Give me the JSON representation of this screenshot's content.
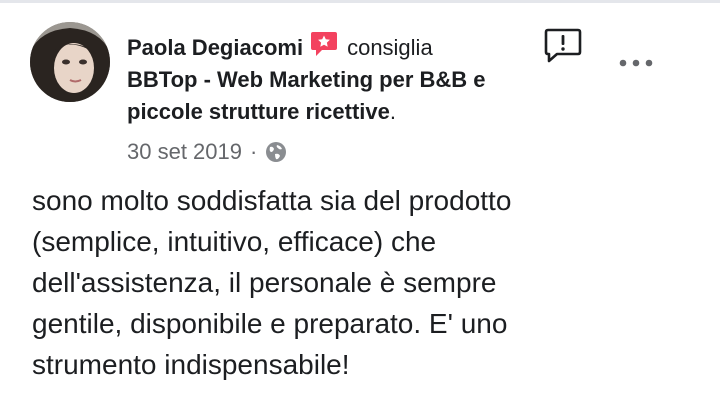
{
  "review": {
    "author": "Paola Degiacomi",
    "verb": "consiglia",
    "page_name": "BBTop - Web Marketing per B&B e piccole strutture ricettive",
    "period": ".",
    "date": "30 set 2019",
    "separator": "·",
    "privacy_icon": "globe-icon",
    "text": "sono molto soddisfatta sia del prodotto\n(semplice, intuitivo, efficace) che\ndell'assistenza, il personale è sempre\ngentile, disponibile e preparato. E' uno\nstrumento indispensabile!"
  },
  "icons": {
    "recommend": "recommend-badge-icon",
    "report": "report-icon",
    "more": "more-options-icon"
  },
  "colors": {
    "recommend_badge": "#f3425f",
    "secondary_text": "#65676b",
    "primary_text": "#1c1e21"
  }
}
